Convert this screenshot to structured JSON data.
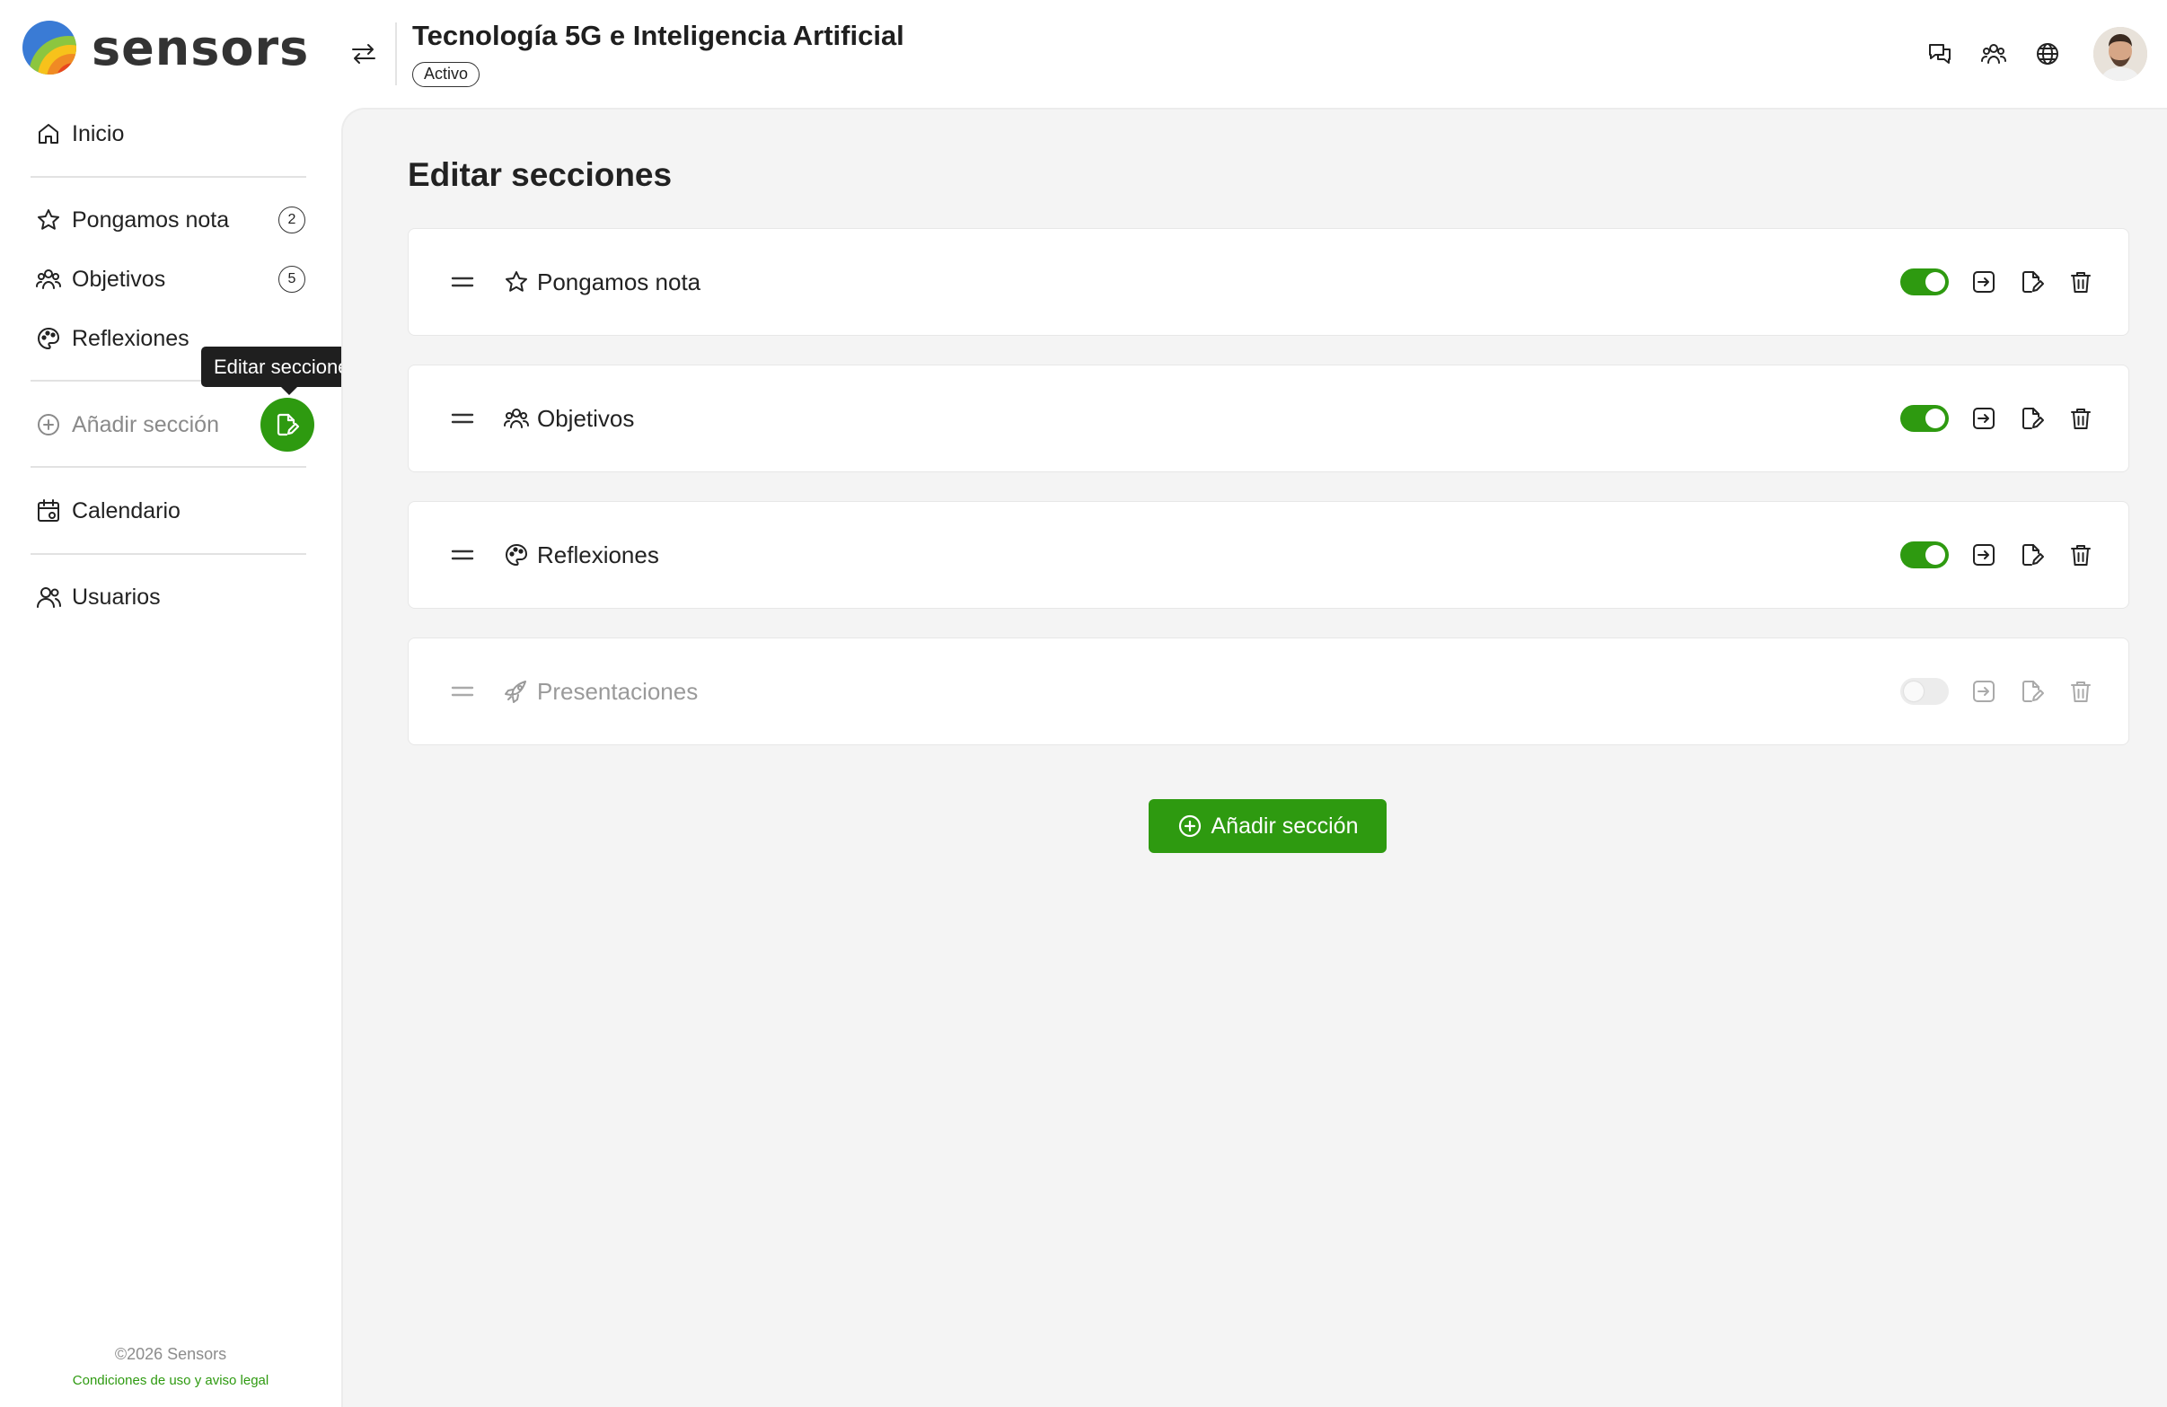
{
  "app": {
    "brand": "sensors"
  },
  "header": {
    "project_title": "Tecnología 5G e Inteligencia Artificial",
    "status": "Activo",
    "icons": [
      "chat-icon",
      "users-icon",
      "globe-icon"
    ]
  },
  "sidebar": {
    "home": "Inicio",
    "sections": [
      {
        "label": "Pongamos nota",
        "count": "2",
        "icon": "star-icon"
      },
      {
        "label": "Objetivos",
        "count": "5",
        "icon": "people-icon"
      },
      {
        "label": "Reflexiones",
        "icon": "palette-icon"
      }
    ],
    "add_section": "Añadir sección",
    "edit_tooltip": "Editar secciones",
    "calendar": "Calendario",
    "users": "Usuarios",
    "footer_copy": "©2026 Sensors",
    "footer_link": "Condiciones de uso y aviso legal"
  },
  "main": {
    "title": "Editar secciones",
    "sections": [
      {
        "name": "Pongamos nota",
        "icon": "star-icon",
        "enabled": true
      },
      {
        "name": "Objetivos",
        "icon": "people-icon",
        "enabled": true
      },
      {
        "name": "Reflexiones",
        "icon": "palette-icon",
        "enabled": true
      },
      {
        "name": "Presentaciones",
        "icon": "rocket-icon",
        "enabled": false
      }
    ],
    "add_button": "Añadir sección"
  },
  "colors": {
    "accent": "#2e9a10",
    "text": "#222222",
    "muted": "#9a9a9a",
    "background": "#f4f4f4"
  }
}
